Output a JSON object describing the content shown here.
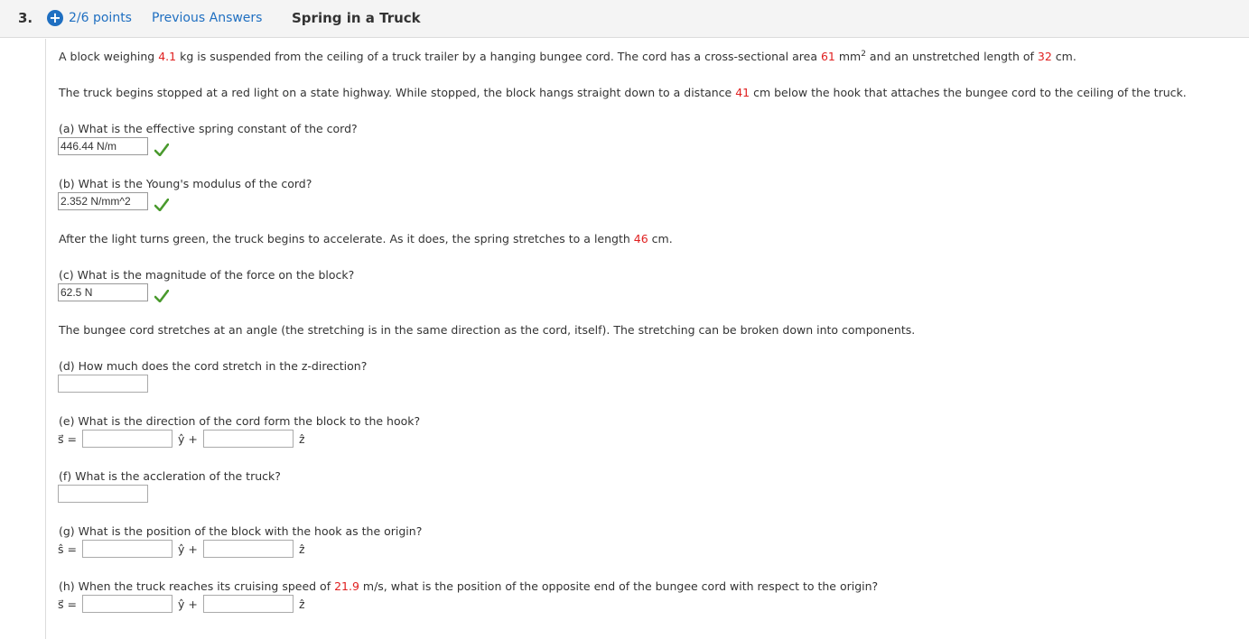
{
  "header": {
    "question_number": "3.",
    "points": "2/6 points",
    "previous_answers": "Previous Answers",
    "title": "Spring in a Truck"
  },
  "intro": {
    "p1_a": "A block weighing ",
    "p1_mass": "4.1",
    "p1_b": " kg is suspended from the ceiling of a truck trailer by a hanging bungee cord. The cord has a cross-sectional area ",
    "p1_area": "61",
    "p1_c": " mm",
    "p1_sup": "2",
    "p1_d": " and an unstretched length of ",
    "p1_len": "32",
    "p1_e": " cm.",
    "p2_a": "The truck begins stopped at a red light on a state highway. While stopped, the block hangs straight down to a distance ",
    "p2_dist": "41",
    "p2_b": " cm below the hook that attaches the bungee cord to the ceiling of the truck."
  },
  "qa": {
    "label": "(a) What is the effective spring constant of the cord?",
    "answer": "446.44 N/m"
  },
  "qb": {
    "label": "(b) What is the Young's modulus of the cord?",
    "answer": "2.352 N/mm^2"
  },
  "green": {
    "a": "After the light turns green, the truck begins to accelerate. As it does, the spring stretches to a length ",
    "len": "46",
    "b": " cm."
  },
  "qc": {
    "label": "(c) What is the magnitude of the force on the block?",
    "answer": "62.5 N"
  },
  "angle_text": "The bungee cord stretches at an angle (the stretching is in the same direction as the cord, itself). The stretching can be broken down into components.",
  "qd": {
    "label": "(d) How much does the cord stretch in the z-direction?"
  },
  "qe": {
    "label": "(e) What is the direction of the cord form the block to the hook?",
    "lhs": "s⃗ =",
    "yhat": "ŷ +",
    "zhat": "ẑ"
  },
  "qf": {
    "label": "(f) What is the accleration of the truck?"
  },
  "qg": {
    "label": "(g) What is the position of the block with the hook as the origin?",
    "lhs": "ŝ =",
    "yhat": "ŷ +",
    "zhat": "ẑ"
  },
  "qh": {
    "label_a": "(h) When the truck reaches its cruising speed of ",
    "speed": "21.9",
    "label_b": " m/s, what is the position of the opposite end of the bungee cord with respect to the origin?",
    "lhs": "s⃗ =",
    "yhat": "ŷ +",
    "zhat": "ẑ"
  },
  "colors": {
    "link": "#1f6fc1",
    "given_value": "#e02020",
    "correct": "#4a9a2e"
  },
  "icons": [
    "plus-icon",
    "check-icon"
  ]
}
